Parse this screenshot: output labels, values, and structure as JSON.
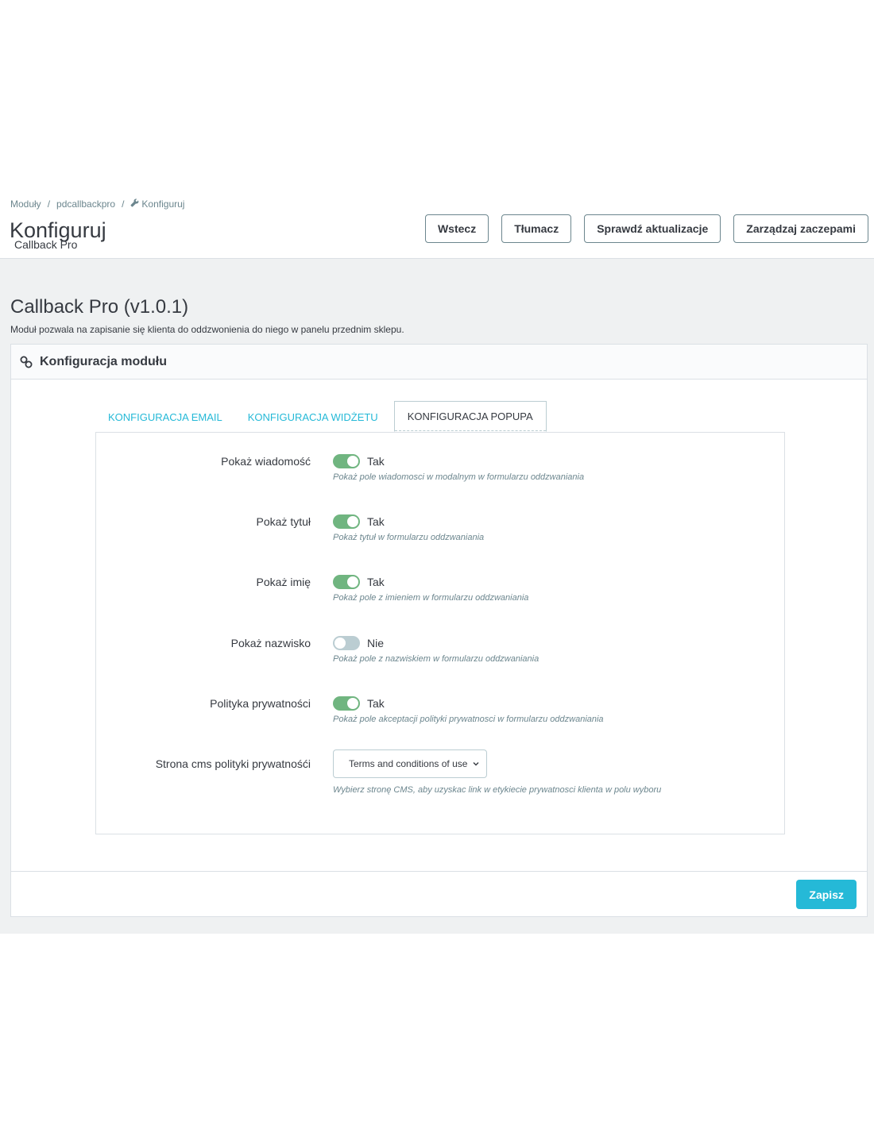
{
  "breadcrumb": {
    "items": [
      "Moduły",
      "pdcallbackpro",
      "Konfiguruj"
    ],
    "separator": "/"
  },
  "header": {
    "title": "Konfiguruj",
    "subtitle": "Callback Pro"
  },
  "toolbar": {
    "back_label": "Wstecz",
    "translate_label": "Tłumacz",
    "check_updates_label": "Sprawdź aktualizacje",
    "manage_hooks_label": "Zarządzaj zaczepami"
  },
  "module": {
    "title": "Callback Pro (v1.0.1)",
    "description": "Moduł pozwala na zapisanie się klienta do oddzwonienia do niego w panelu przednim sklepu."
  },
  "panel": {
    "heading": "Konfiguracja modułu",
    "heading_icon": "link-icon"
  },
  "tabs": [
    {
      "label": "KONFIGURACJA EMAIL",
      "active": false
    },
    {
      "label": "KONFIGURACJA WIDŻETU",
      "active": false
    },
    {
      "label": "KONFIGURACJA POPUPA",
      "active": true
    }
  ],
  "fields": [
    {
      "label": "Pokaż wiadomość",
      "value": "Tak",
      "on": true,
      "help": "Pokaż pole wiadomosci w modalnym w formularzu oddzwaniania"
    },
    {
      "label": "Pokaż tytuł",
      "value": "Tak",
      "on": true,
      "help": "Pokaż tytuł w formularzu oddzwaniania"
    },
    {
      "label": "Pokaż imię",
      "value": "Tak",
      "on": true,
      "help": "Pokaż pole z imieniem w formularzu oddzwaniania"
    },
    {
      "label": "Pokaż nazwisko",
      "value": "Nie",
      "on": false,
      "help": "Pokaż pole z nazwiskiem w formularzu oddzwaniania"
    },
    {
      "label": "Polityka prywatności",
      "value": "Tak",
      "on": true,
      "help": "Pokaż pole akceptacji polityki prywatnosci w formularzu oddzwaniania"
    }
  ],
  "cms_field": {
    "label": "Strona cms polityki prywatnośći",
    "selected": "Terms and conditions of use",
    "help": "Wybierz stronę CMS, aby uzyskac link w etykiecie prywatnosci klienta w polu wyboru"
  },
  "footer": {
    "save_label": "Zapisz"
  },
  "colors": {
    "accent": "#25b9d7",
    "switch_on": "#70b580",
    "switch_off": "#bbcdd2",
    "background": "#eff1f2"
  }
}
